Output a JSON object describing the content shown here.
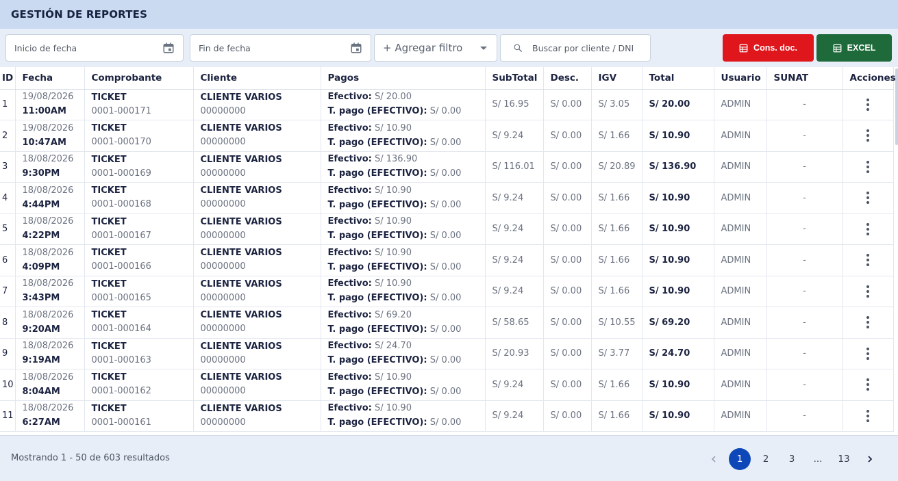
{
  "header": {
    "title": "GESTIÓN DE REPORTES"
  },
  "toolbar": {
    "start_date_placeholder": "Inicio de fecha",
    "end_date_placeholder": "Fin de fecha",
    "add_filter_label": "+ Agregar filtro",
    "search_placeholder": "Buscar por cliente / DNI",
    "cons_doc_label": "Cons. doc.",
    "excel_label": "EXCEL"
  },
  "table": {
    "columns": [
      "ID",
      "Fecha",
      "Comprobante",
      "Cliente",
      "Pagos",
      "SubTotal",
      "Desc.",
      "IGV",
      "Total",
      "Usuario",
      "SUNAT",
      "Acciones"
    ],
    "payment_label": "Efectivo:",
    "payment_type_label": "T. pago (EFECTIVO):",
    "rows": [
      {
        "id": "1",
        "date": "19/08/2026",
        "time": "11:00AM",
        "doc_type": "TICKET",
        "doc_number": "0001-000171",
        "client": "CLIENTE VARIOS",
        "client_doc": "00000000",
        "cash": "S/ 20.00",
        "pay_type": "S/ 0.00",
        "subtotal": "S/ 16.95",
        "discount": "S/ 0.00",
        "igv": "S/ 3.05",
        "total": "S/ 20.00",
        "user": "ADMIN",
        "sunat": "-"
      },
      {
        "id": "2",
        "date": "19/08/2026",
        "time": "10:47AM",
        "doc_type": "TICKET",
        "doc_number": "0001-000170",
        "client": "CLIENTE VARIOS",
        "client_doc": "00000000",
        "cash": "S/ 10.90",
        "pay_type": "S/ 0.00",
        "subtotal": "S/ 9.24",
        "discount": "S/ 0.00",
        "igv": "S/ 1.66",
        "total": "S/ 10.90",
        "user": "ADMIN",
        "sunat": "-"
      },
      {
        "id": "3",
        "date": "18/08/2026",
        "time": "9:30PM",
        "doc_type": "TICKET",
        "doc_number": "0001-000169",
        "client": "CLIENTE VARIOS",
        "client_doc": "00000000",
        "cash": "S/ 136.90",
        "pay_type": "S/ 0.00",
        "subtotal": "S/ 116.01",
        "discount": "S/ 0.00",
        "igv": "S/ 20.89",
        "total": "S/ 136.90",
        "user": "ADMIN",
        "sunat": "-"
      },
      {
        "id": "4",
        "date": "18/08/2026",
        "time": "4:44PM",
        "doc_type": "TICKET",
        "doc_number": "0001-000168",
        "client": "CLIENTE VARIOS",
        "client_doc": "00000000",
        "cash": "S/ 10.90",
        "pay_type": "S/ 0.00",
        "subtotal": "S/ 9.24",
        "discount": "S/ 0.00",
        "igv": "S/ 1.66",
        "total": "S/ 10.90",
        "user": "ADMIN",
        "sunat": "-"
      },
      {
        "id": "5",
        "date": "18/08/2026",
        "time": "4:22PM",
        "doc_type": "TICKET",
        "doc_number": "0001-000167",
        "client": "CLIENTE VARIOS",
        "client_doc": "00000000",
        "cash": "S/ 10.90",
        "pay_type": "S/ 0.00",
        "subtotal": "S/ 9.24",
        "discount": "S/ 0.00",
        "igv": "S/ 1.66",
        "total": "S/ 10.90",
        "user": "ADMIN",
        "sunat": "-"
      },
      {
        "id": "6",
        "date": "18/08/2026",
        "time": "4:09PM",
        "doc_type": "TICKET",
        "doc_number": "0001-000166",
        "client": "CLIENTE VARIOS",
        "client_doc": "00000000",
        "cash": "S/ 10.90",
        "pay_type": "S/ 0.00",
        "subtotal": "S/ 9.24",
        "discount": "S/ 0.00",
        "igv": "S/ 1.66",
        "total": "S/ 10.90",
        "user": "ADMIN",
        "sunat": "-"
      },
      {
        "id": "7",
        "date": "18/08/2026",
        "time": "3:43PM",
        "doc_type": "TICKET",
        "doc_number": "0001-000165",
        "client": "CLIENTE VARIOS",
        "client_doc": "00000000",
        "cash": "S/ 10.90",
        "pay_type": "S/ 0.00",
        "subtotal": "S/ 9.24",
        "discount": "S/ 0.00",
        "igv": "S/ 1.66",
        "total": "S/ 10.90",
        "user": "ADMIN",
        "sunat": "-"
      },
      {
        "id": "8",
        "date": "18/08/2026",
        "time": "9:20AM",
        "doc_type": "TICKET",
        "doc_number": "0001-000164",
        "client": "CLIENTE VARIOS",
        "client_doc": "00000000",
        "cash": "S/ 69.20",
        "pay_type": "S/ 0.00",
        "subtotal": "S/ 58.65",
        "discount": "S/ 0.00",
        "igv": "S/ 10.55",
        "total": "S/ 69.20",
        "user": "ADMIN",
        "sunat": "-"
      },
      {
        "id": "9",
        "date": "18/08/2026",
        "time": "9:19AM",
        "doc_type": "TICKET",
        "doc_number": "0001-000163",
        "client": "CLIENTE VARIOS",
        "client_doc": "00000000",
        "cash": "S/ 24.70",
        "pay_type": "S/ 0.00",
        "subtotal": "S/ 20.93",
        "discount": "S/ 0.00",
        "igv": "S/ 3.77",
        "total": "S/ 24.70",
        "user": "ADMIN",
        "sunat": "-"
      },
      {
        "id": "10",
        "date": "18/08/2026",
        "time": "8:04AM",
        "doc_type": "TICKET",
        "doc_number": "0001-000162",
        "client": "CLIENTE VARIOS",
        "client_doc": "00000000",
        "cash": "S/ 10.90",
        "pay_type": "S/ 0.00",
        "subtotal": "S/ 9.24",
        "discount": "S/ 0.00",
        "igv": "S/ 1.66",
        "total": "S/ 10.90",
        "user": "ADMIN",
        "sunat": "-"
      },
      {
        "id": "11",
        "date": "18/08/2026",
        "time": "6:27AM",
        "doc_type": "TICKET",
        "doc_number": "0001-000161",
        "client": "CLIENTE VARIOS",
        "client_doc": "00000000",
        "cash": "S/ 10.90",
        "pay_type": "S/ 0.00",
        "subtotal": "S/ 9.24",
        "discount": "S/ 0.00",
        "igv": "S/ 1.66",
        "total": "S/ 10.90",
        "user": "ADMIN",
        "sunat": "-"
      }
    ]
  },
  "footer": {
    "results_text": "Mostrando 1 - 50 de 603 resultados",
    "pages": [
      "1",
      "2",
      "3",
      "...",
      "13"
    ],
    "active_page": "1"
  },
  "colors": {
    "header_bg": "#c9daf1",
    "cons_doc_button": "#e0161d",
    "excel_button": "#1f6a3a",
    "active_page": "#0d47b8"
  }
}
